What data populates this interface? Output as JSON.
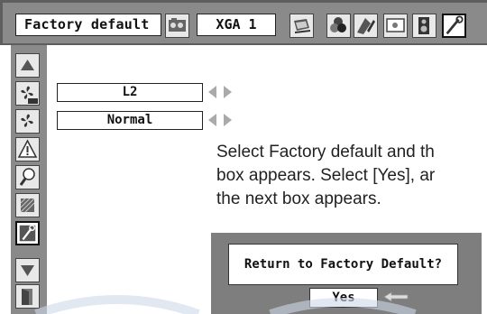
{
  "header": {
    "title": "Factory default",
    "mode_value": "XGA 1",
    "icons": [
      "image-adjust-icon",
      "pc-adjust-icon",
      "color-icon",
      "screen-icon",
      "setting-icon",
      "sound-icon",
      "factory-default-icon"
    ]
  },
  "sidebar": {
    "items": [
      "arrow-up-icon",
      "fan-off-icon",
      "fan-icon",
      "warning-icon",
      "lamp-icon",
      "filter-icon",
      "factory-default-icon",
      "arrow-down-icon",
      "exit-icon"
    ]
  },
  "fields": {
    "lamp_mode": "L2",
    "fan_mode": "Normal"
  },
  "description": {
    "line1": "Select Factory default and th",
    "line2": "box appears. Select [Yes], ar",
    "line3": "the next box appears."
  },
  "dialog": {
    "prompt": "Return to Factory Default?",
    "yes_label": "Yes"
  },
  "colors": {
    "menu_gray": "#8a8a8a",
    "menu_dark": "#5e5e5e",
    "box_white": "#ffffff",
    "icon_bg": "#e8e8e8"
  }
}
